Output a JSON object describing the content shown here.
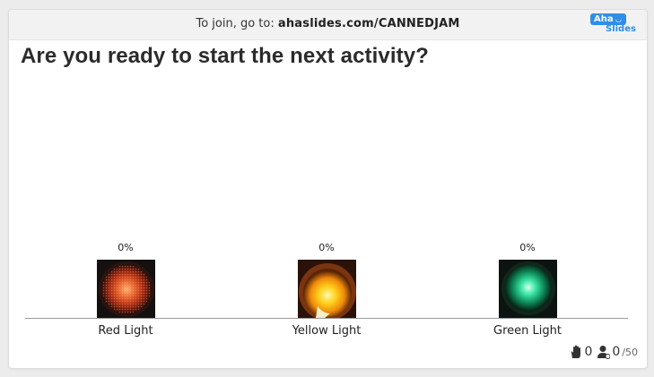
{
  "header": {
    "join_prefix": "To join, go to: ",
    "join_url": "ahaslides.com/CANNEDJAM",
    "logo_top": "Aha",
    "logo_bottom": "Slides"
  },
  "question": "Are you ready to start the next activity?",
  "options": [
    {
      "label": "Red Light",
      "percent": "0%",
      "image_icon": "red-traffic-light"
    },
    {
      "label": "Yellow Light",
      "percent": "0%",
      "image_icon": "yellow-traffic-light"
    },
    {
      "label": "Green Light",
      "percent": "0%",
      "image_icon": "green-traffic-light"
    }
  ],
  "stats": {
    "reactions": "0",
    "participants": "0",
    "participants_total": "/50"
  },
  "colors": {
    "brand": "#2f8ee8",
    "baseline": "#9a9a9a"
  }
}
